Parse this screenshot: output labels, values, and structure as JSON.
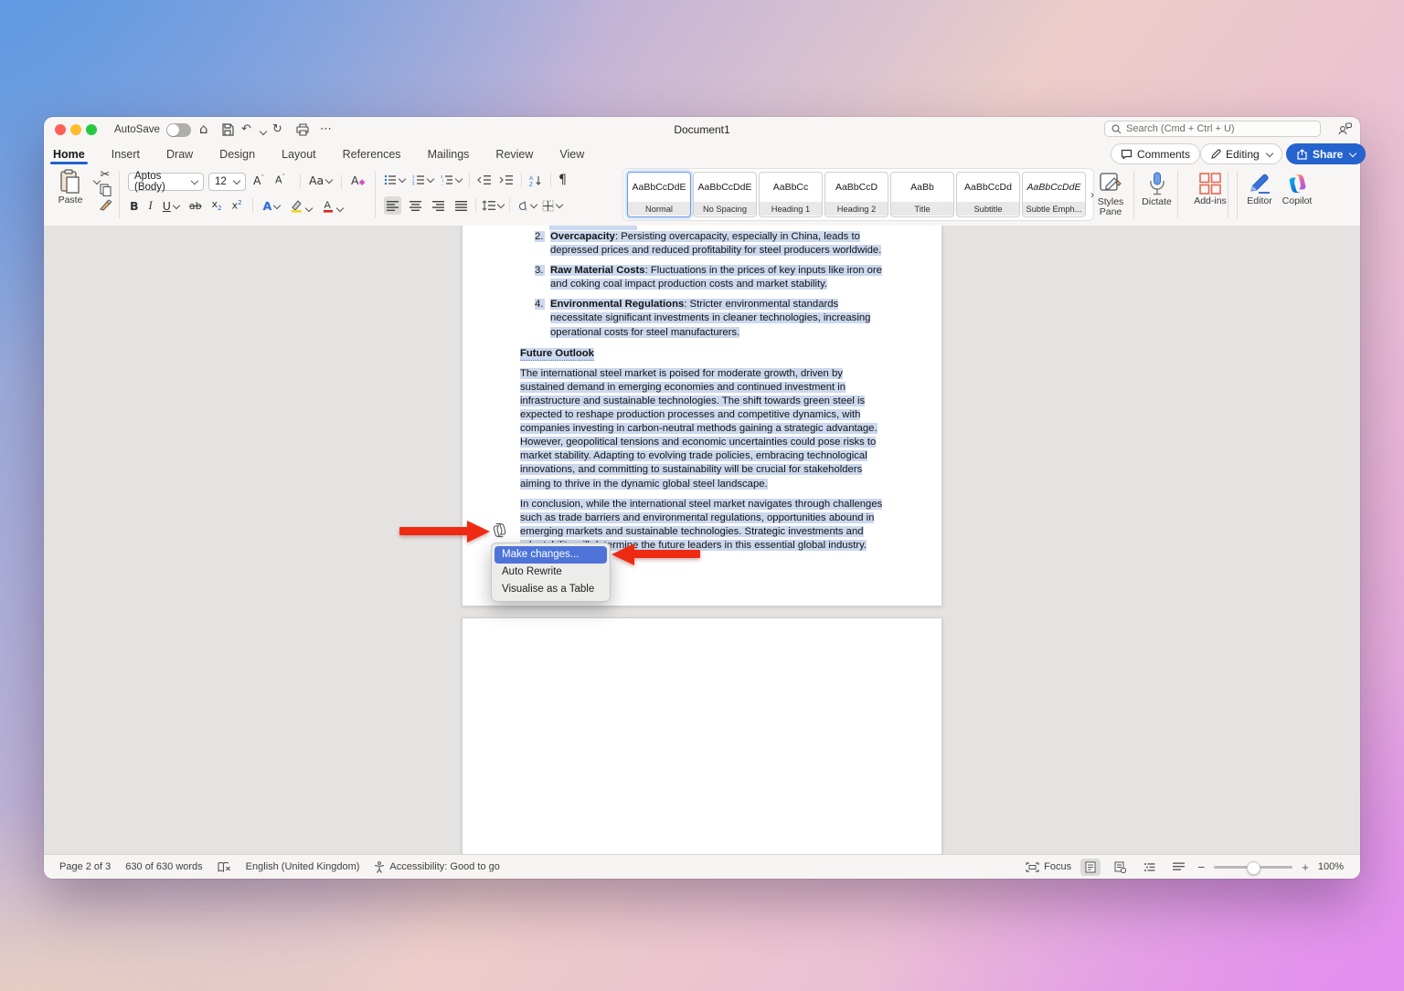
{
  "titlebar": {
    "autosave_label": "AutoSave",
    "document_title": "Document1",
    "search_placeholder": "Search (Cmd + Ctrl + U)"
  },
  "tabs": [
    {
      "label": "Home"
    },
    {
      "label": "Insert"
    },
    {
      "label": "Draw"
    },
    {
      "label": "Design"
    },
    {
      "label": "Layout"
    },
    {
      "label": "References"
    },
    {
      "label": "Mailings"
    },
    {
      "label": "Review"
    },
    {
      "label": "View"
    }
  ],
  "actions": {
    "comments": "Comments",
    "editing": "Editing",
    "share": "Share"
  },
  "ribbon": {
    "paste": "Paste",
    "font_name": "Aptos (Body)",
    "font_size": "12",
    "styles_gallery": [
      {
        "sample": "AaBbCcDdE",
        "label": "Normal"
      },
      {
        "sample": "AaBbCcDdE",
        "label": "No Spacing"
      },
      {
        "sample": "AaBbCc",
        "label": "Heading 1"
      },
      {
        "sample": "AaBbCcD",
        "label": "Heading 2"
      },
      {
        "sample": "AaBb",
        "label": "Title"
      },
      {
        "sample": "AaBbCcDd",
        "label": "Subtitle"
      },
      {
        "sample": "AaBbCcDdE",
        "label": "Subtle Emph..."
      }
    ],
    "styles_pane": "Styles Pane",
    "dictate": "Dictate",
    "addins": "Add-ins",
    "editor": "Editor",
    "copilot": "Copilot"
  },
  "document": {
    "list_items": [
      {
        "number": "2.",
        "lead": "Overcapacity",
        "text": ": Persisting overcapacity, especially in China, leads to depressed prices and reduced profitability for steel producers worldwide."
      },
      {
        "number": "3.",
        "lead": "Raw Material Costs",
        "text": ": Fluctuations in the prices of key inputs like iron ore and coking coal impact production costs and market stability."
      },
      {
        "number": "4.",
        "lead": "Environmental Regulations",
        "text": ": Stricter environmental standards necessitate significant investments in cleaner technologies, increasing operational costs for steel manufacturers."
      }
    ],
    "heading": "Future Outlook",
    "paragraph_1": "The international steel market is poised for moderate growth, driven by sustained demand in emerging economies and continued investment in infrastructure and sustainable technologies. The shift towards green steel is expected to reshape production processes and competitive dynamics, with companies investing in carbon-neutral methods gaining a strategic advantage. However, geopolitical tensions and economic uncertainties could pose risks to market stability. Adapting to evolving trade policies, embracing technological innovations, and committing to sustainability will be crucial for stakeholders aiming to thrive in the dynamic global steel landscape.",
    "paragraph_2": "In conclusion, while the international steel market navigates through challenges such as trade barriers and environmental regulations, opportunities abound in emerging markets and sustainable technologies. Strategic investments and adaptability will determine the future leaders in this essential global industry."
  },
  "copilot_menu": {
    "items": [
      {
        "label": "Make changes..."
      },
      {
        "label": "Auto Rewrite"
      },
      {
        "label": "Visualise as a Table"
      }
    ]
  },
  "status_bar": {
    "page_info": "Page 2 of 3",
    "word_count": "630 of 630 words",
    "language": "English (United Kingdom)",
    "accessibility": "Accessibility: Good to go",
    "focus": "Focus",
    "zoom": "100%"
  },
  "colors": {
    "accent_blue": "#2563cf",
    "selection_highlight": "#cbd8ee",
    "menu_selected": "#4e74d9",
    "arrow_red": "#ee2b12"
  }
}
